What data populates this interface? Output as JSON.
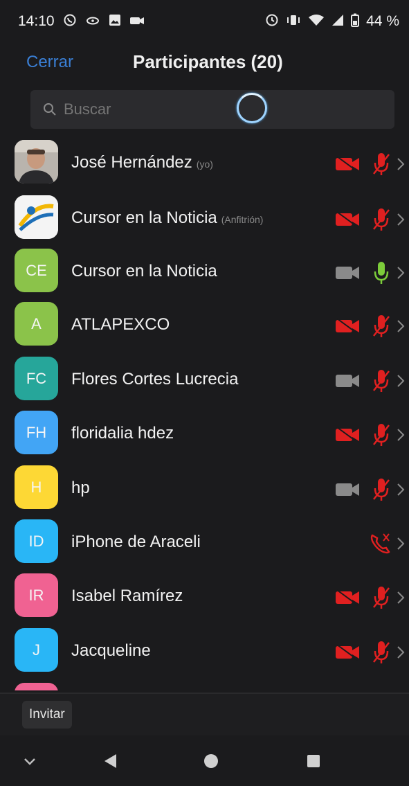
{
  "status_bar": {
    "time": "14:10",
    "battery": "44 %"
  },
  "header": {
    "close_label": "Cerrar",
    "title": "Participantes (20)"
  },
  "search": {
    "placeholder": "Buscar"
  },
  "participants": [
    {
      "name": "José Hernández",
      "tag": "(yo)",
      "avatar": "photo-jose",
      "video": "off",
      "audio": "muted"
    },
    {
      "name": "Cursor en la Noticia",
      "tag": "(Anfitrión)",
      "avatar": "logo-cursor",
      "video": "off",
      "audio": "muted"
    },
    {
      "name": "Cursor en la Noticia",
      "tag": "",
      "avatar_initials": "CE",
      "avatar_color": "#8bc34a",
      "video": "on",
      "audio": "on"
    },
    {
      "name": "ATLAPEXCO",
      "tag": "",
      "avatar_initials": "A",
      "avatar_color": "#8bc34a",
      "video": "off",
      "audio": "muted"
    },
    {
      "name": "Flores Cortes Lucrecia",
      "tag": "",
      "avatar_initials": "FC",
      "avatar_color": "#26a69a",
      "video": "on",
      "audio": "muted"
    },
    {
      "name": "floridalia hdez",
      "tag": "",
      "avatar_initials": "FH",
      "avatar_color": "#42a5f5",
      "video": "off",
      "audio": "muted"
    },
    {
      "name": "hp",
      "tag": "",
      "avatar_initials": "H",
      "avatar_color": "#fdd835",
      "video": "on",
      "audio": "muted"
    },
    {
      "name": "iPhone de Araceli",
      "tag": "",
      "avatar_initials": "ID",
      "avatar_color": "#29b6f6",
      "video": "none",
      "audio": "phone"
    },
    {
      "name": "Isabel Ramírez",
      "tag": "",
      "avatar_initials": "IR",
      "avatar_color": "#f06292",
      "video": "off",
      "audio": "muted"
    },
    {
      "name": "Jacqueline",
      "tag": "",
      "avatar_initials": "J",
      "avatar_color": "#29b6f6",
      "video": "off",
      "audio": "muted"
    }
  ],
  "bottom_bar": {
    "invite_label": "Invitar"
  },
  "colors": {
    "accent": "#3a7fd5",
    "muted_red": "#e02020",
    "active_green": "#7ccc3a",
    "video_on_gray": "#8a8a8a"
  }
}
